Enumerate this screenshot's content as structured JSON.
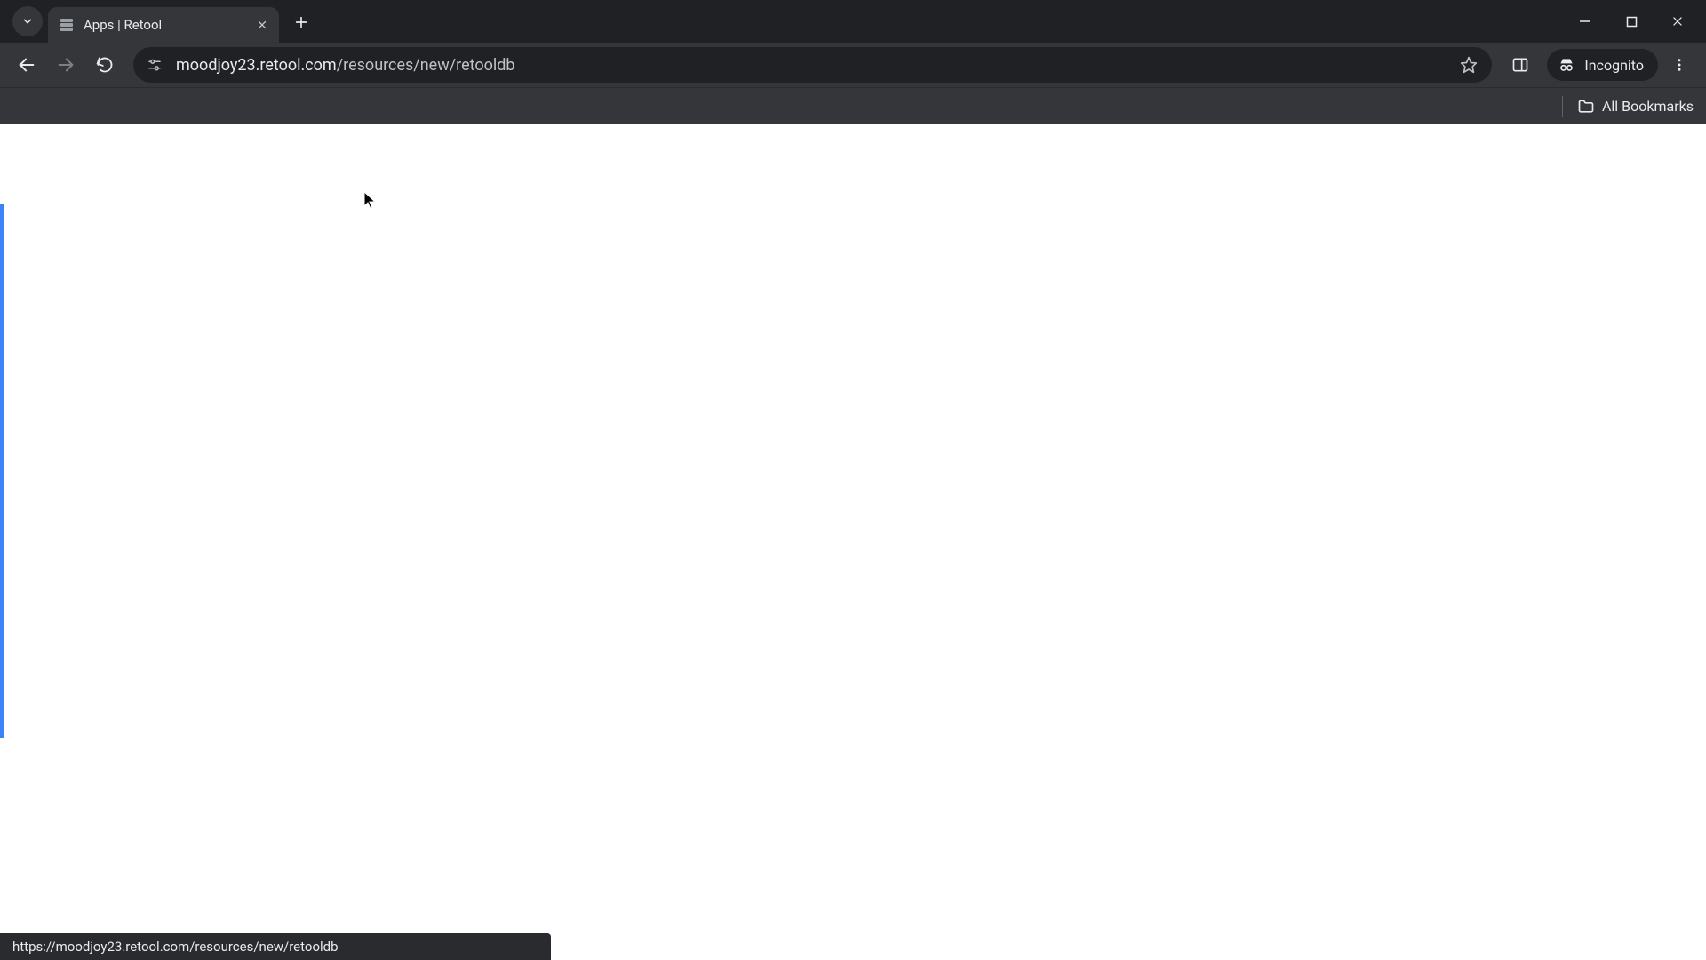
{
  "browser": {
    "tab_title": "Apps | Retool",
    "url_host": "moodjoy23.retool.com",
    "url_path": "/resources/new/retooldb",
    "incognito_label": "Incognito",
    "bookmarks_label": "All Bookmarks",
    "status_url": "https://moodjoy23.retool.com/resources/new/retooldb"
  }
}
